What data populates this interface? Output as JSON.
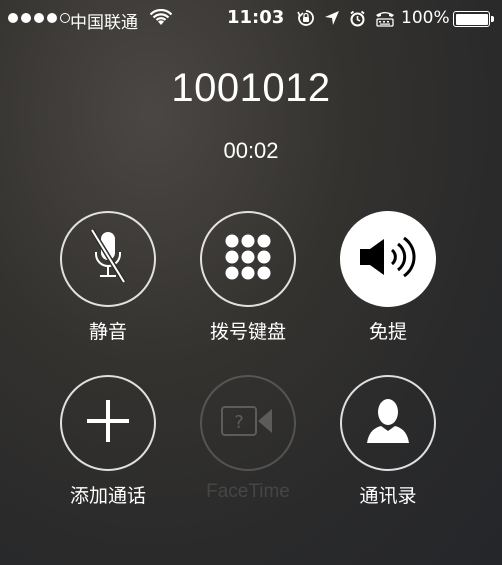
{
  "status_bar": {
    "carrier": "中国联通",
    "time": "11:03",
    "battery_percent": "100%",
    "signal_strength": 4,
    "signal_max": 5,
    "icons": [
      "wifi-icon",
      "rotation-lock-icon",
      "location-icon",
      "alarm-icon",
      "tty-icon",
      "battery-icon"
    ]
  },
  "call": {
    "number": "1001012",
    "duration": "00:02"
  },
  "controls": {
    "mute": {
      "label": "静音",
      "icon": "mic-muted-icon"
    },
    "keypad": {
      "label": "拨号键盘",
      "icon": "keypad-icon"
    },
    "speaker": {
      "label": "免提",
      "icon": "speaker-icon",
      "active": true
    },
    "add_call": {
      "label": "添加通话",
      "icon": "plus-icon"
    },
    "facetime": {
      "label": "FaceTime",
      "icon": "facetime-icon",
      "disabled": true
    },
    "contacts": {
      "label": "通讯录",
      "icon": "contact-icon"
    }
  },
  "colors": {
    "foreground": "#ffffff",
    "active_button": "#ffffff",
    "icon_on_active": "#000000"
  }
}
